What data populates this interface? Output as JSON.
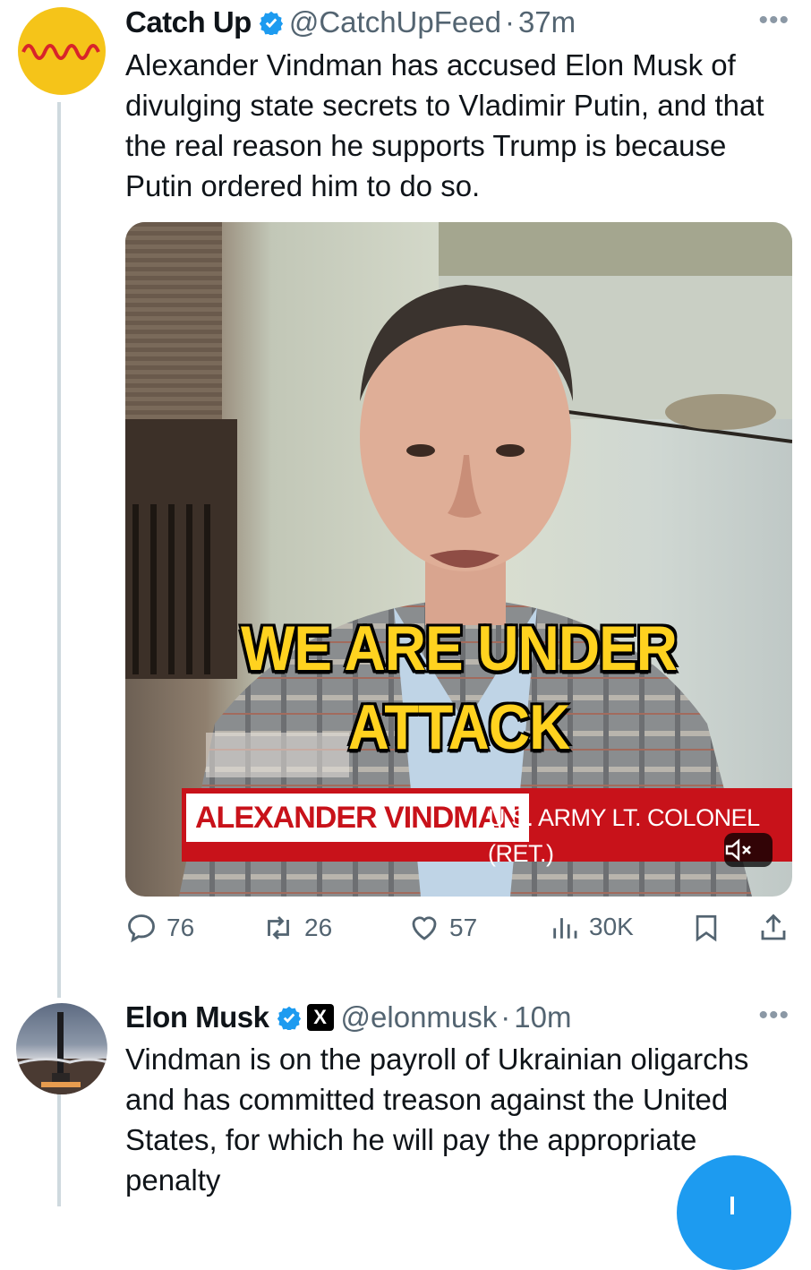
{
  "tweets": [
    {
      "name": "Catch Up",
      "handle": "@CatchUpFeed",
      "separator": "·",
      "time": "37m",
      "more": "•••",
      "text": "Alexander Vindman has accused Elon Musk of divulging state secrets to Vladimir Putin, and that the real reason he supports Trump is because Putin ordered him to do so.",
      "media": {
        "caption_line1": "WE ARE UNDER",
        "caption_line2": "ATTACK",
        "lower_third_name": "ALEXANDER VINDMAN",
        "lower_third_title": "U.S. ARMY LT. COLONEL (RET.)",
        "mute_icon": "speaker-muted-icon"
      },
      "stats": {
        "replies": "76",
        "reposts": "26",
        "likes": "57",
        "views": "30K"
      }
    },
    {
      "name": "Elon Musk",
      "affiliate_badge": "X",
      "handle": "@elonmusk",
      "separator": "·",
      "time": "10m",
      "more": "•••",
      "text": "Vindman is on the payroll of Ukrainian oligarchs and has committed treason against the United States, for which he will pay the appropriate penalty"
    }
  ],
  "colors": {
    "accent": "#1d9bf0",
    "secondary_text": "#536471",
    "caption_yellow": "#ffd21f",
    "lower_third_red": "#c8121a",
    "avatar_yellow": "#f5c419"
  },
  "icons": [
    "verified-badge-icon",
    "reply-icon",
    "repost-icon",
    "like-icon",
    "views-icon",
    "bookmark-icon",
    "share-icon",
    "compose-icon"
  ]
}
